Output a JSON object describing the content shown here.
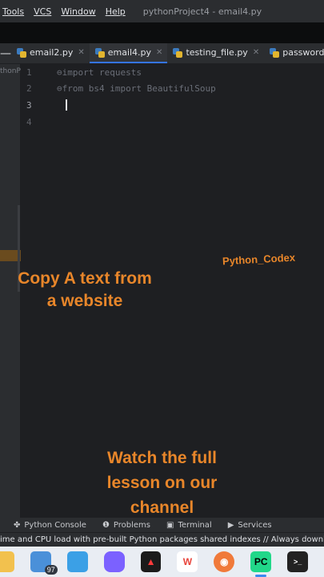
{
  "menu": {
    "items": [
      "Tools",
      "VCS",
      "Window",
      "Help"
    ],
    "window_title": "pythonProject4 - email4.py"
  },
  "tabs": [
    {
      "label": "email2.py",
      "active": false
    },
    {
      "label": "email4.py",
      "active": true
    },
    {
      "label": "testing_file.py",
      "active": false
    },
    {
      "label": "password",
      "active": false
    }
  ],
  "project_panel": {
    "label": "thonP"
  },
  "editor": {
    "line_numbers": [
      "1",
      "2",
      "3",
      "4"
    ],
    "current_line": "3",
    "lines": [
      {
        "keyword": "import",
        "rest": " requests"
      },
      {
        "keyword": "from",
        "rest": " bs4 ",
        "keyword2": "import",
        "rest2": " BeautifulSoup"
      }
    ]
  },
  "overlay": {
    "watermark": "Python_Codex",
    "caption_top": [
      "Copy A text from",
      "a website"
    ],
    "caption_bottom": [
      "Watch the full",
      "lesson on our",
      "channel"
    ],
    "color": "#e8862a"
  },
  "tool_windows": [
    {
      "label": "Python Console",
      "icon": "python-console-icon"
    },
    {
      "label": "Problems",
      "icon": "problems-icon"
    },
    {
      "label": "Terminal",
      "icon": "terminal-icon"
    },
    {
      "label": "Services",
      "icon": "services-icon"
    }
  ],
  "status_message": "ime and CPU load with pre-built Python packages shared indexes // Always downl",
  "taskbar": {
    "apps": [
      {
        "name": "file-explorer-icon",
        "color": "#f2c14e"
      },
      {
        "name": "mail-icon",
        "color": "#4a90d9",
        "badge": "97"
      },
      {
        "name": "photos-icon",
        "color": "#3ba0e6"
      },
      {
        "name": "copilot-icon",
        "color": "#7b61ff"
      },
      {
        "name": "adobe-icon",
        "color": "#1b1b1b"
      },
      {
        "name": "wps-icon",
        "color": "#e8453c"
      },
      {
        "name": "recorder-icon",
        "color": "#f07a3a"
      },
      {
        "name": "pycharm-icon",
        "color": "#21d789",
        "text": "PC",
        "active": true
      },
      {
        "name": "terminal-app-icon",
        "color": "#222222"
      }
    ]
  }
}
